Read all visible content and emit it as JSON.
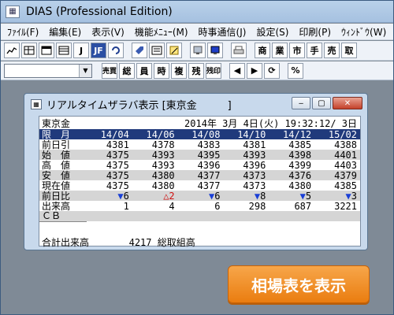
{
  "app": {
    "title": "DIAS (Professional Edition)",
    "menu": [
      "ﾌｧｲﾙ(F)",
      "編集(E)",
      "表示(V)",
      "機能ﾒﾆｭｰ(M)",
      "時事通信(J)",
      "設定(S)",
      "印刷(P)",
      "ｳｨﾝﾄﾞｳ(W)"
    ],
    "toolbar1": {
      "labels": [
        "J",
        "JF",
        "商",
        "業",
        "市",
        "手",
        "売",
        "取"
      ]
    },
    "toolbar2": {
      "combo_value": "",
      "labels": [
        "売買",
        "総",
        "員",
        "時",
        "複",
        "残",
        "残印",
        "◀",
        "▶",
        "⟳",
        "%"
      ]
    }
  },
  "window": {
    "title": "リアルタイムザラバ表示 [東京金　　　]",
    "buttons": [
      "‒",
      "▢",
      "✕"
    ]
  },
  "quote": {
    "name": "東京金",
    "datetime": "2014年 3月 4日(火) 19:32:12/ 3日",
    "header_label": "限　月",
    "months": [
      "14/04",
      "14/06",
      "14/08",
      "14/10",
      "14/12",
      "15/02"
    ],
    "rows": [
      {
        "label": "前日引",
        "values": [
          "4381",
          "4378",
          "4383",
          "4381",
          "4385",
          "4388"
        ]
      },
      {
        "label": "始　値",
        "values": [
          "4375",
          "4393",
          "4395",
          "4393",
          "4398",
          "4401"
        ]
      },
      {
        "label": "高　値",
        "values": [
          "4375",
          "4393",
          "4396",
          "4396",
          "4399",
          "4403"
        ]
      },
      {
        "label": "安　値",
        "values": [
          "4375",
          "4380",
          "4377",
          "4373",
          "4376",
          "4379"
        ]
      },
      {
        "label": "現在値",
        "values": [
          "4375",
          "4380",
          "4377",
          "4373",
          "4380",
          "4385"
        ]
      }
    ],
    "change": {
      "label": "前日比",
      "values": [
        {
          "dir": "down",
          "mark": "▼",
          "value": "6"
        },
        {
          "dir": "up",
          "mark": "△",
          "value": "2"
        },
        {
          "dir": "down",
          "mark": "▼",
          "value": "6"
        },
        {
          "dir": "down",
          "mark": "▼",
          "value": "8"
        },
        {
          "dir": "down",
          "mark": "▼",
          "value": "5"
        },
        {
          "dir": "down",
          "mark": "▼",
          "value": "3"
        }
      ]
    },
    "volume": {
      "label": "出来高",
      "values": [
        "1",
        "4",
        "6",
        "298",
        "687",
        "3221"
      ]
    },
    "cb": {
      "label": "ＣＢ"
    },
    "footer": {
      "total_label": "合計出来高",
      "total_value": "4217",
      "oi_label": "総取組高"
    }
  },
  "cta": {
    "label": "相場表を表示"
  },
  "colors": {
    "header_bg": "#203a7c",
    "up": "#d01010",
    "down": "#1a3fd6",
    "cta": "#ea7d10"
  }
}
